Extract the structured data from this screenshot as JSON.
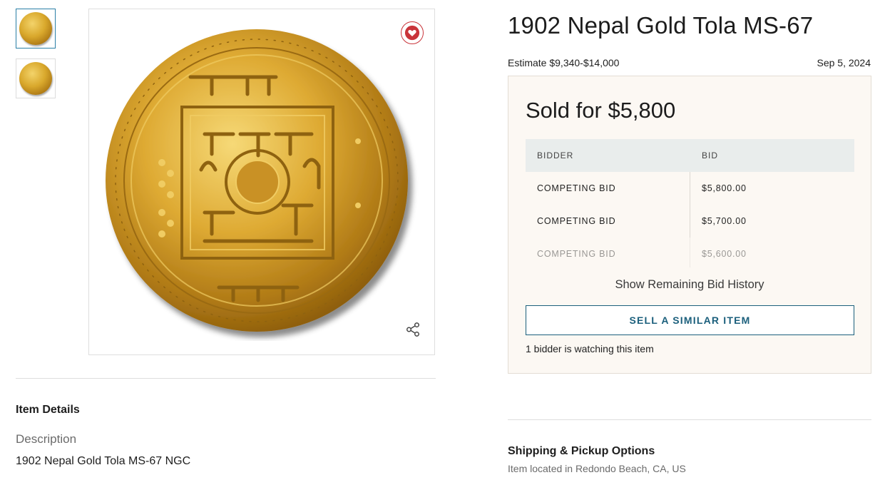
{
  "gallery": {
    "thumbnails": [
      {
        "icon": "coin-obverse-thumbnail",
        "active": true
      },
      {
        "icon": "coin-reverse-thumbnail",
        "active": false
      }
    ]
  },
  "coin_icon": "gold-coin-image",
  "icons": {
    "favorite": "heart-icon",
    "share": "share-icon"
  },
  "colors": {
    "accent": "#1b5f7c",
    "heart": "#c9343a",
    "panel_bg": "#fcf8f3",
    "table_header_bg": "#e9edec",
    "gold": "#d4a12c"
  },
  "lot": {
    "title": "1902 Nepal Gold Tola MS-67",
    "estimate": "Estimate $9,340-$14,000",
    "date": "Sep 5, 2024"
  },
  "sale": {
    "sold_label": "Sold for $5,800",
    "table": {
      "headers": [
        "BIDDER",
        "BID"
      ],
      "rows": [
        {
          "bidder": "COMPETING BID",
          "bid": "$5,800.00"
        },
        {
          "bidder": "COMPETING BID",
          "bid": "$5,700.00"
        },
        {
          "bidder": "COMPETING BID",
          "bid": "$5,600.00"
        }
      ]
    },
    "show_history": "Show Remaining Bid History",
    "sell_button": "SELL A SIMILAR ITEM",
    "watching": "1 bidder is watching this item"
  },
  "details": {
    "heading": "Item Details",
    "description_label": "Description",
    "description": "1902 Nepal Gold Tola MS-67 NGC"
  },
  "shipping": {
    "heading": "Shipping & Pickup Options",
    "location": "Item located in Redondo Beach, CA, US"
  }
}
